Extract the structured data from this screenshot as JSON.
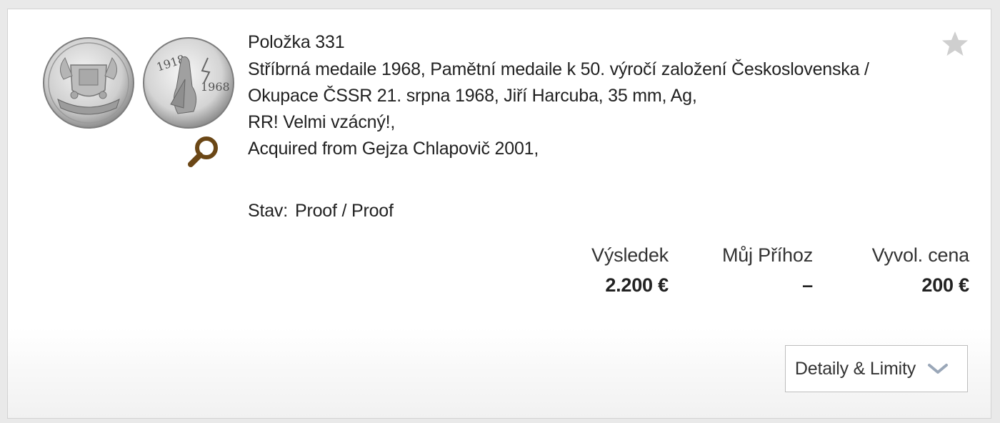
{
  "lot": {
    "number_label": "Položka 331",
    "description_lines": [
      "Stříbrná medaile 1968, Pamětní medaile k 50. výročí založení Československa /",
      "Okupace ČSSR 21. srpna 1968, Jiří Harcuba, 35 mm, Ag,",
      "RR! Velmi vzácný!,",
      "Acquired from Gejza Chlapovič 2001,"
    ],
    "condition_label": "Stav:",
    "condition_value": "Proof / Proof",
    "coin_reverse_years": [
      "1918",
      "1968"
    ]
  },
  "prices": {
    "result": {
      "label": "Výsledek",
      "value": "2.200 €"
    },
    "my_bid": {
      "label": "Můj Příhoz",
      "value": "–"
    },
    "starting_price": {
      "label": "Vyvol. cena",
      "value": "200 €"
    }
  },
  "actions": {
    "details_label": "Detaily & Limity"
  },
  "icons": {
    "favorite": "star-icon",
    "zoom": "magnifier-icon",
    "expand": "chevron-down-icon"
  },
  "colors": {
    "zoom_icon": "#6b4716",
    "star_icon": "#cfcfcf",
    "chevron": "#9aa7b8"
  }
}
